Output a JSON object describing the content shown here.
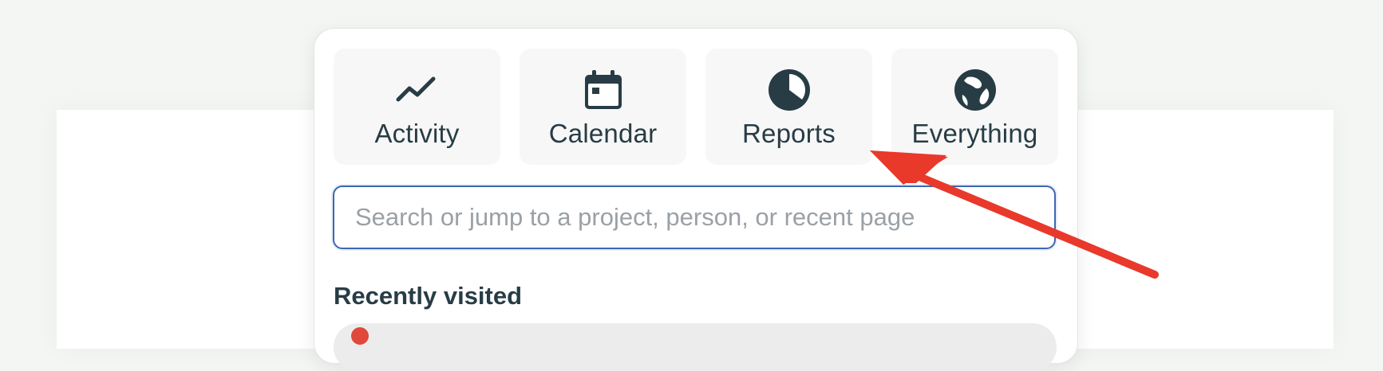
{
  "tiles": [
    {
      "label": "Activity",
      "icon": "activity-icon"
    },
    {
      "label": "Calendar",
      "icon": "calendar-icon"
    },
    {
      "label": "Reports",
      "icon": "reports-icon"
    },
    {
      "label": "Everything",
      "icon": "everything-icon"
    }
  ],
  "search": {
    "placeholder": "Search or jump to a project, person, or recent page",
    "value": ""
  },
  "recent": {
    "title": "Recently visited"
  },
  "colors": {
    "text": "#283c46",
    "tile_bg": "#f7f7f7",
    "focus_border": "#3b68b3",
    "annotation_arrow": "#e8392b"
  }
}
